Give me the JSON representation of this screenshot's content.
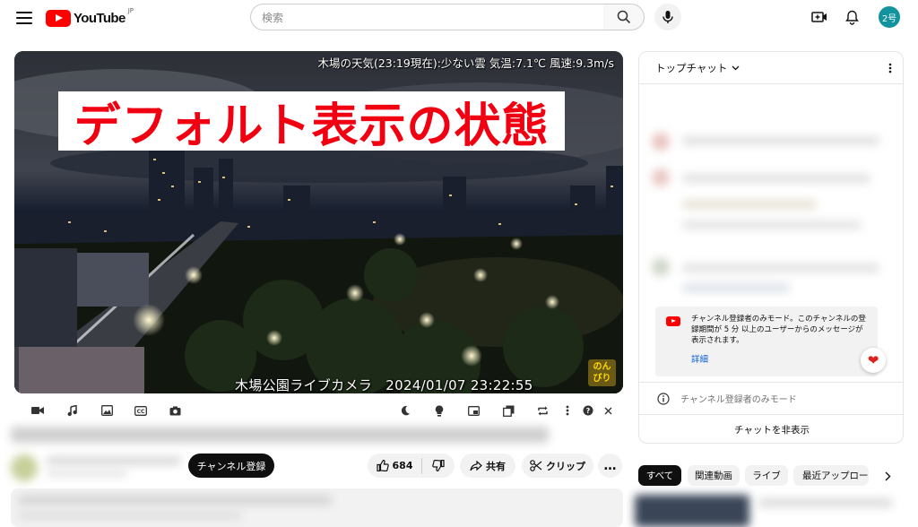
{
  "header": {
    "logo_text": "YouTube",
    "region": "JP",
    "search_placeholder": "検索",
    "avatar_text": "2号"
  },
  "player": {
    "weather_overlay": "木場の天気(23:19現在):少ない雲 気温:7.1℃ 風速:9.3m/s",
    "banner_text": "デフォルト表示の状態",
    "camera_caption": "木場公園ライブカメラ　2024/01/07 23:22:55",
    "stamp_text": [
      "のん",
      "びり"
    ]
  },
  "toolbar_icons": [
    "video-icon",
    "music-icon",
    "image-icon",
    "cc-icon",
    "camera-icon",
    "moon-icon",
    "lightbulb-icon",
    "miniplayer-icon",
    "copy-icon",
    "loop-icon",
    "more-vert-icon",
    "help-icon",
    "close-icon"
  ],
  "actions": {
    "subscribe_label": "チャンネル登録",
    "like_count": "684",
    "share_label": "共有",
    "clip_label": "クリップ",
    "more_label": "…"
  },
  "chat": {
    "title": "トップチャット",
    "notice_text": "チャンネル登録者のみモード。このチャンネルの登録期間が 5 分 以上のユーザーからのメッセージが表示されます。",
    "notice_link": "詳細",
    "mode_label": "チャンネル登録者のみモード",
    "hide_label": "チャットを非表示"
  },
  "chips": [
    "すべて",
    "関連動画",
    "ライブ",
    "最近アップロード"
  ],
  "colors": {
    "brand_red": "#ff0000",
    "avatar": "#12939e",
    "banner_text": "#f00010",
    "link": "#065fd4"
  }
}
